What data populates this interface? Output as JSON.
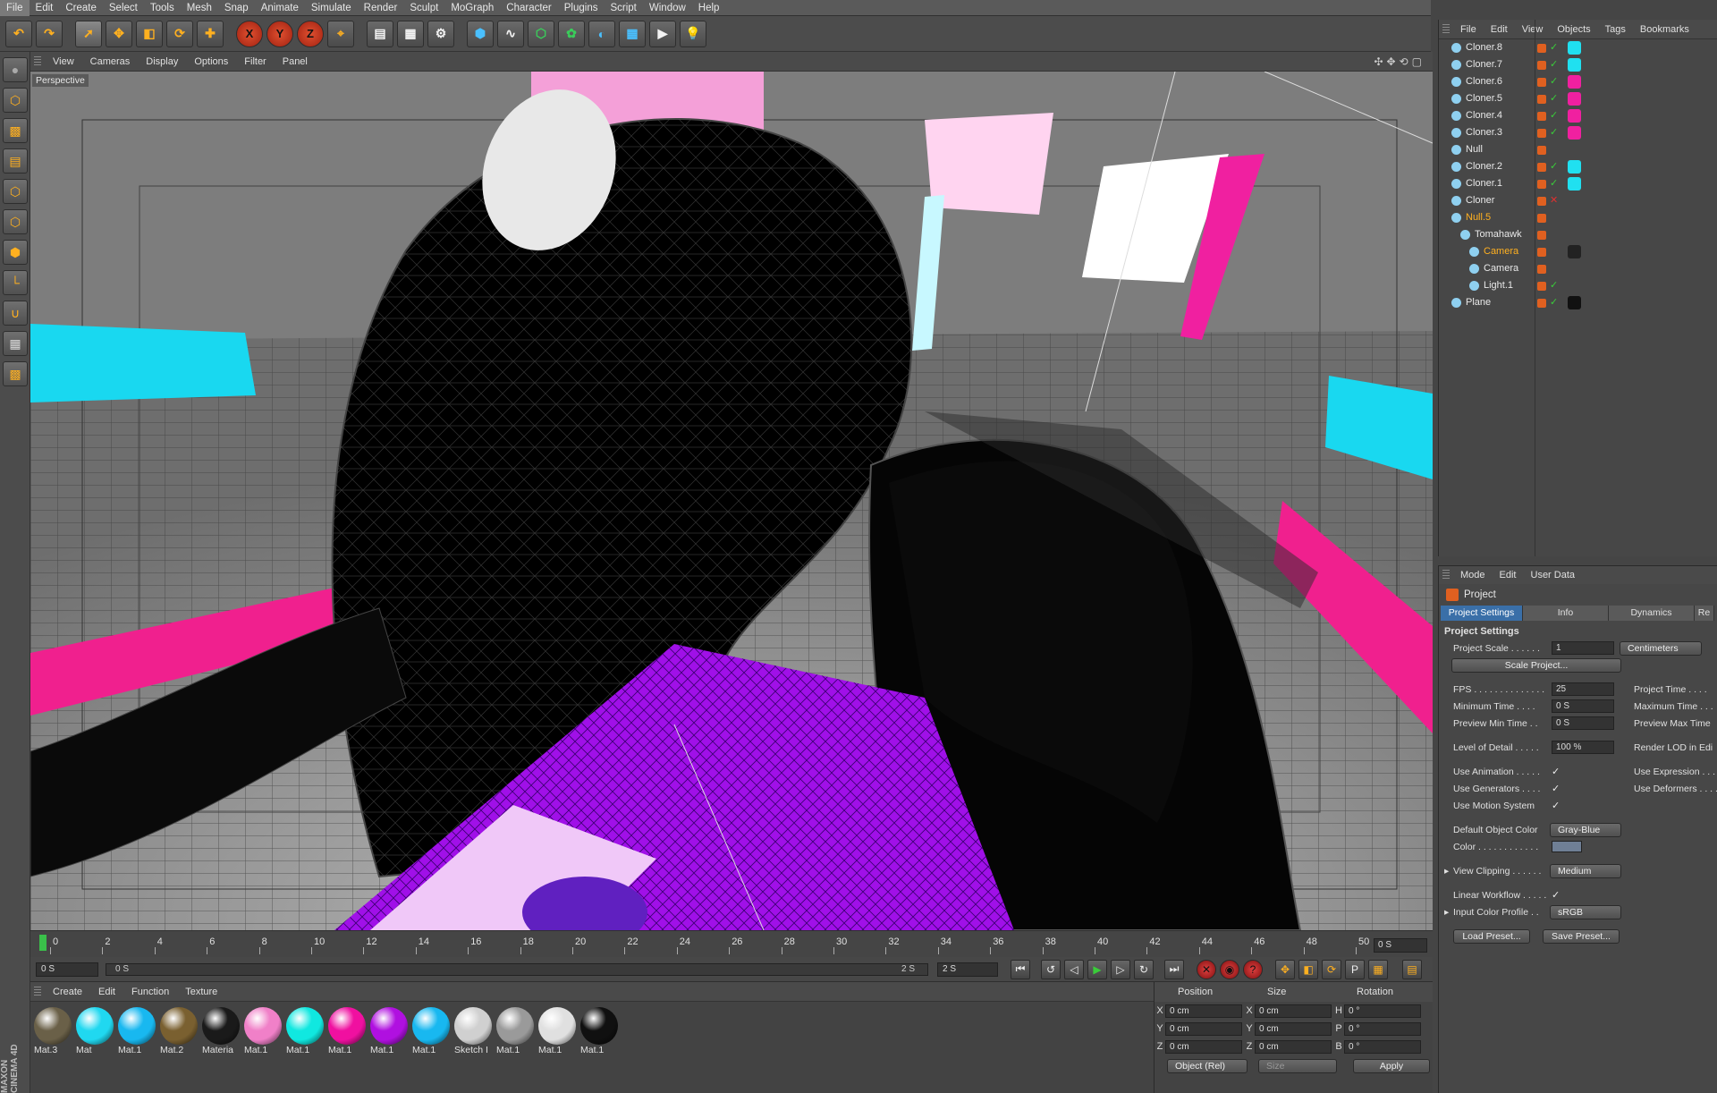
{
  "menubar": [
    "File",
    "Edit",
    "Create",
    "Select",
    "Tools",
    "Mesh",
    "Snap",
    "Animate",
    "Simulate",
    "Render",
    "Sculpt",
    "MoGraph",
    "Character",
    "Plugins",
    "Script",
    "Window",
    "Help"
  ],
  "toolbar_icons": [
    "undo-icon",
    "redo-icon",
    "select-arrow-icon",
    "move-icon",
    "scale-icon",
    "rotate-icon",
    "move-all-icon",
    "x-axis-icon",
    "y-axis-icon",
    "z-axis-icon",
    "coordinate-system-icon",
    "render-view-icon",
    "render-picture-queue-icon",
    "render-settings-icon",
    "cube-primitive-icon",
    "spline-pen-icon",
    "nurbs-icon",
    "cloner-icon",
    "deformer-icon",
    "floor-icon",
    "camera-icon",
    "light-icon"
  ],
  "viewport": {
    "menu": [
      "View",
      "Cameras",
      "Display",
      "Options",
      "Filter",
      "Panel"
    ],
    "label": "Perspective"
  },
  "timeline": {
    "ticks": [
      "0",
      "2",
      "4",
      "6",
      "8",
      "10",
      "12",
      "14",
      "16",
      "18",
      "20",
      "22",
      "24",
      "26",
      "28",
      "30",
      "32",
      "34",
      "36",
      "38",
      "40",
      "42",
      "44",
      "46",
      "48",
      "50"
    ],
    "end_field": "0 S"
  },
  "transport": {
    "start": "0 S",
    "current": "0 S",
    "end_in_bar": "2 S",
    "max": "2 S"
  },
  "materials": {
    "menu": [
      "Create",
      "Edit",
      "Function",
      "Texture"
    ],
    "items": [
      {
        "label": "Mat.3",
        "color": "#6a6048"
      },
      {
        "label": "Mat",
        "color": "#20d8f0"
      },
      {
        "label": "Mat.1",
        "color": "#18b8f0"
      },
      {
        "label": "Mat.2",
        "color": "#7a6030"
      },
      {
        "label": "Materia",
        "color": "#1a1a1a"
      },
      {
        "label": "Mat.1",
        "color": "#f080c8"
      },
      {
        "label": "Mat.1",
        "color": "#10e8e0"
      },
      {
        "label": "Mat.1",
        "color": "#f010a0"
      },
      {
        "label": "Mat.1",
        "color": "#b010e0"
      },
      {
        "label": "Mat.1",
        "color": "#18b8f0"
      },
      {
        "label": "Sketch I",
        "color": "#d0d0d0"
      },
      {
        "label": "Mat.1",
        "color": "#9a9a9a"
      },
      {
        "label": "Mat.1",
        "color": "#e0e0e0"
      },
      {
        "label": "Mat.1",
        "color": "#101010"
      }
    ]
  },
  "coordinates": {
    "headers": [
      "Position",
      "Size",
      "Rotation"
    ],
    "rows": [
      {
        "a": "X",
        "p": "0 cm",
        "s_ax": "X",
        "s": "0 cm",
        "r_ax": "H",
        "r": "0 °"
      },
      {
        "a": "Y",
        "p": "0 cm",
        "s_ax": "Y",
        "s": "0 cm",
        "r_ax": "P",
        "r": "0 °"
      },
      {
        "a": "Z",
        "p": "0 cm",
        "s_ax": "Z",
        "s": "0 cm",
        "r_ax": "B",
        "r": "0 °"
      }
    ],
    "mode_dropdown": "Object (Rel)",
    "size_dropdown": "Size",
    "apply": "Apply"
  },
  "objects": {
    "menu": [
      "File",
      "Edit",
      "View",
      "Objects",
      "Tags",
      "Bookmarks"
    ],
    "items": [
      {
        "name": "Cloner.8",
        "indent": 0,
        "tag": "#20e0f0",
        "check": "✓"
      },
      {
        "name": "Cloner.7",
        "indent": 0,
        "tag": "#20e0f0",
        "check": "✓"
      },
      {
        "name": "Cloner.6",
        "indent": 0,
        "tag": "#f020a0",
        "check": "✓"
      },
      {
        "name": "Cloner.5",
        "indent": 0,
        "tag": "#f020a0",
        "check": "✓"
      },
      {
        "name": "Cloner.4",
        "indent": 0,
        "tag": "#f020a0",
        "check": "✓"
      },
      {
        "name": "Cloner.3",
        "indent": 0,
        "tag": "#f020a0",
        "check": "✓"
      },
      {
        "name": "Null",
        "indent": 0,
        "tag": "",
        "check": ""
      },
      {
        "name": "Cloner.2",
        "indent": 0,
        "tag": "#20e0f0",
        "check": "✓"
      },
      {
        "name": "Cloner.1",
        "indent": 0,
        "tag": "#20e0f0",
        "check": "✓"
      },
      {
        "name": "Cloner",
        "indent": 0,
        "tag": "",
        "check": "✕"
      },
      {
        "name": "Null.5",
        "indent": 0,
        "tag": "",
        "check": "",
        "hl": true
      },
      {
        "name": "Tomahawk",
        "indent": 1,
        "tag": "",
        "check": ""
      },
      {
        "name": "Camera",
        "indent": 2,
        "tag": "#222222",
        "check": "",
        "hl": true
      },
      {
        "name": "Camera",
        "indent": 2,
        "tag": "",
        "check": ""
      },
      {
        "name": "Light.1",
        "indent": 2,
        "tag": "",
        "check": "✓"
      },
      {
        "name": "Plane",
        "indent": 0,
        "tag": "#111111",
        "check": "✓"
      }
    ]
  },
  "attributes": {
    "menu": [
      "Mode",
      "Edit",
      "User Data"
    ],
    "title": "Project",
    "tabs": [
      "Project Settings",
      "Info",
      "Dynamics",
      "Re"
    ],
    "section": "Project Settings",
    "project_scale_label": "Project Scale . . . . . .",
    "project_scale_value": "1",
    "scale_unit": "Centimeters",
    "scale_project_btn": "Scale Project...",
    "fps_label": "FPS . . . . . . . . . . . . . .",
    "fps_value": "25",
    "project_time_label": "Project Time . . . .",
    "min_time_label": "Minimum Time . . . .",
    "min_time_value": "0 S",
    "max_time_label": "Maximum Time . . .",
    "prev_min_label": "Preview Min Time . .",
    "prev_min_value": "0 S",
    "prev_max_label": "Preview Max Time",
    "lod_label": "Level of Detail . . . . .",
    "lod_value": "100 %",
    "render_lod_label": "Render LOD in Edi",
    "use_anim_label": "Use Animation . . . . .",
    "use_expr_label": "Use Expression . . .",
    "use_gen_label": "Use Generators . . . .",
    "use_def_label": "Use Deformers . . . .",
    "use_motion_label": "Use Motion System",
    "check": "✓",
    "default_color_label": "Default Object Color",
    "default_color_value": "Gray-Blue",
    "color_label": "Color . . . . . . . . . . . .",
    "view_clip_label": "View Clipping . . . . . .",
    "view_clip_value": "Medium",
    "linear_label": "Linear Workflow . . . . .",
    "input_profile_label": "Input Color Profile . .",
    "input_profile_value": "sRGB",
    "load_preset": "Load Preset...",
    "save_preset": "Save Preset..."
  },
  "brand": "MAXON CINEMA 4D",
  "colors": {
    "cyan": "#19d8f0",
    "magenta": "#f0208e",
    "violet": "#a010e8",
    "accent_orange": "#ffb020"
  }
}
